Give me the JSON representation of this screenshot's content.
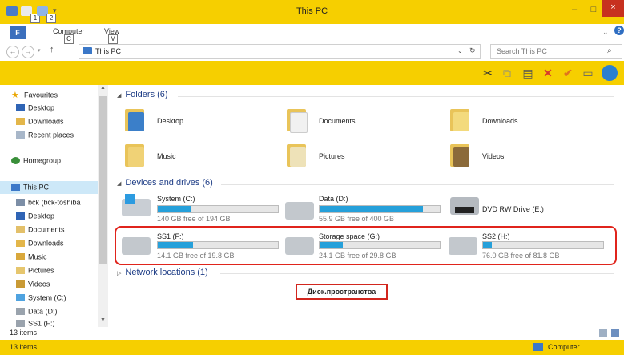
{
  "window": {
    "title": "This PC"
  },
  "ribbon": {
    "file_label": "F",
    "tabs": [
      {
        "label": "Computer",
        "key": "C"
      },
      {
        "label": "View",
        "key": "V"
      }
    ]
  },
  "quick_access": {
    "key_1": "1",
    "key_2": "2"
  },
  "controls": {
    "minimize": "–",
    "maximize": "□",
    "close": "×"
  },
  "address": {
    "path": "This PC",
    "search_placeholder": "Search This PC"
  },
  "nav": {
    "favourites": {
      "title": "Favourites",
      "items": [
        "Desktop",
        "Downloads",
        "Recent places"
      ]
    },
    "homegroup": "Homegroup",
    "this_pc": {
      "title": "This PC",
      "items": [
        "bck (bck-toshiba",
        "Desktop",
        "Documents",
        "Downloads",
        "Music",
        "Pictures",
        "Videos",
        "System (C:)",
        "Data (D:)",
        "SS1 (F:)"
      ]
    }
  },
  "folders": {
    "header": "Folders (6)",
    "items": [
      "Desktop",
      "Documents",
      "Downloads",
      "Music",
      "Pictures",
      "Videos"
    ]
  },
  "devices": {
    "header": "Devices and drives (6)",
    "drives": [
      {
        "name": "System (C:)",
        "free": "140 GB free of 194 GB",
        "used_fraction": 0.28
      },
      {
        "name": "Data (D:)",
        "free": "55.9 GB free of 400 GB",
        "used_fraction": 0.86
      },
      {
        "name": "DVD RW Drive (E:)",
        "free": "",
        "used_fraction": null
      },
      {
        "name": "SS1 (F:)",
        "free": "14.1 GB free of 19.8 GB",
        "used_fraction": 0.29
      },
      {
        "name": "Storage space (G:)",
        "free": "24.1 GB free of 29.8 GB",
        "used_fraction": 0.19
      },
      {
        "name": "SS2 (H:)",
        "free": "76.0 GB free of 81.8 GB",
        "used_fraction": 0.07
      }
    ]
  },
  "network": {
    "header": "Network locations (1)"
  },
  "annotation": {
    "callout": "Диск.пространства"
  },
  "status": {
    "count_top": "13 items",
    "count_bottom": "13 items",
    "location": "Computer"
  },
  "colors": {
    "accent": "#f6cf00",
    "bar_fill": "#26a0da",
    "annotation": "#e0241c"
  }
}
